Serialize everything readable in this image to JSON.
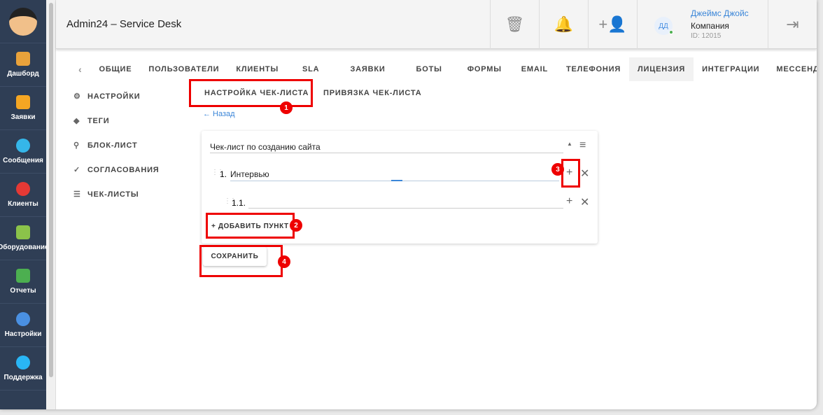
{
  "sidebar": {
    "items": [
      {
        "label": "Дашборд",
        "color": "#e9a23b"
      },
      {
        "label": "Заявки",
        "color": "#f5a623"
      },
      {
        "label": "Сообщения",
        "color": "#35b6e9"
      },
      {
        "label": "Клиенты",
        "color": "#e53935"
      },
      {
        "label": "Оборудование",
        "color": "#8bc34a"
      },
      {
        "label": "Отчеты",
        "color": "#4caf50"
      },
      {
        "label": "Настройки",
        "color": "#4a90e2"
      },
      {
        "label": "Поддержка",
        "color": "#29b6f6"
      }
    ]
  },
  "header": {
    "title": "Admin24 – Service Desk",
    "user": {
      "initials": "ДД",
      "name": "Джеймс Джойс",
      "company": "Компания",
      "id": "ID: 12015"
    }
  },
  "tabs": [
    "ОБЩИЕ",
    "ПОЛЬЗОВАТЕЛИ",
    "КЛИЕНТЫ",
    "SLA",
    "ЗАЯВКИ",
    "БОТЫ",
    "ФОРМЫ",
    "EMAIL",
    "ТЕЛЕФОНИЯ",
    "ЛИЦЕНЗИЯ",
    "ИНТЕГРАЦИИ",
    "МЕССЕНДЖЕРЫ"
  ],
  "left_menu": [
    "НАСТРОЙКИ",
    "ТЕГИ",
    "БЛОК-ЛИСТ",
    "СОГЛАСОВАНИЯ",
    "ЧЕК-ЛИСТЫ"
  ],
  "subtabs": [
    "НАСТРОЙКА ЧЕК-ЛИСТА",
    "ПРИВЯЗКА ЧЕК-ЛИСТА"
  ],
  "back": "← Назад",
  "checklist": {
    "name": "Чек-лист по созданию сайта",
    "items": [
      {
        "num": "1.",
        "value": "Интервью"
      },
      {
        "num": "1.1.",
        "value": ""
      }
    ],
    "add_label": "ДОБАВИТЬ ПУНКТ"
  },
  "save_label": "СОХРАНИТЬ",
  "badges": [
    "1",
    "2",
    "3",
    "4"
  ]
}
